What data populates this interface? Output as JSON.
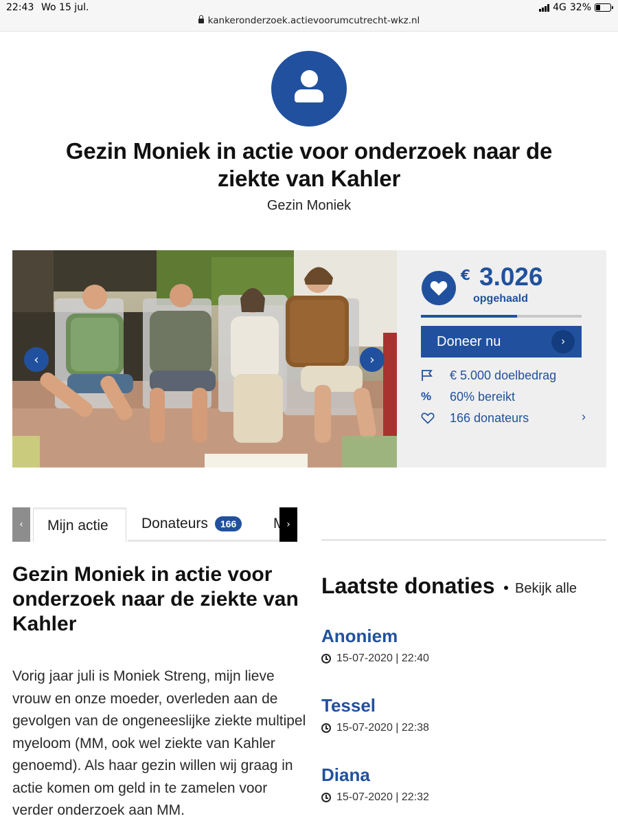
{
  "status_bar": {
    "time": "22:43",
    "date": "Wo 15 jul.",
    "network": "4G",
    "battery": "32%",
    "battery_level": 0.32
  },
  "browser": {
    "url": "kankeronderzoek.actievoorumcutrecht-wkz.nl"
  },
  "header": {
    "avatar_icon": "user-icon",
    "title": "Gezin Moniek in actie voor onderzoek naar de ziekte van Kahler",
    "subtitle": "Gezin Moniek"
  },
  "carousel": {
    "prev_icon": "chevron-left-icon",
    "next_icon": "chevron-right-icon"
  },
  "stats": {
    "currency_symbol": "€",
    "raised": "3.026",
    "raised_label": "opgehaald",
    "progress_fraction": 0.6,
    "donate_label": "Doneer nu",
    "rows": [
      {
        "icon": "flag-icon",
        "text": "€ 5.000 doelbedrag"
      },
      {
        "icon": "percent-icon",
        "text": "60% bereikt"
      },
      {
        "icon": "heart-icon",
        "text": "166 donateurs"
      }
    ]
  },
  "tabs": {
    "active": "Mijn actie",
    "donors": "Donateurs",
    "donors_count": "166",
    "more": "M"
  },
  "story": {
    "title": "Gezin Moniek in actie voor onderzoek naar de ziekte van Kahler",
    "body": "Vorig jaar juli is Moniek Streng, mijn lieve vrouw en onze moeder, overleden aan de gevolgen van de ongeneeslijke ziekte multipel myeloom (MM, ook wel ziekte van Kahler genoemd). Als haar gezin willen wij graag in actie komen om geld in te zamelen voor verder onderzoek aan MM."
  },
  "donations": {
    "heading": "Laatste donaties",
    "see_all": "Bekijk alle",
    "items": [
      {
        "name": "Anoniem",
        "time": "15-07-2020 | 22:40"
      },
      {
        "name": "Tessel",
        "time": "15-07-2020 | 22:38"
      },
      {
        "name": "Diana",
        "time": "15-07-2020 | 22:32"
      }
    ]
  },
  "colors": {
    "brand_blue": "#21519e",
    "panel_grey": "#efefef"
  }
}
